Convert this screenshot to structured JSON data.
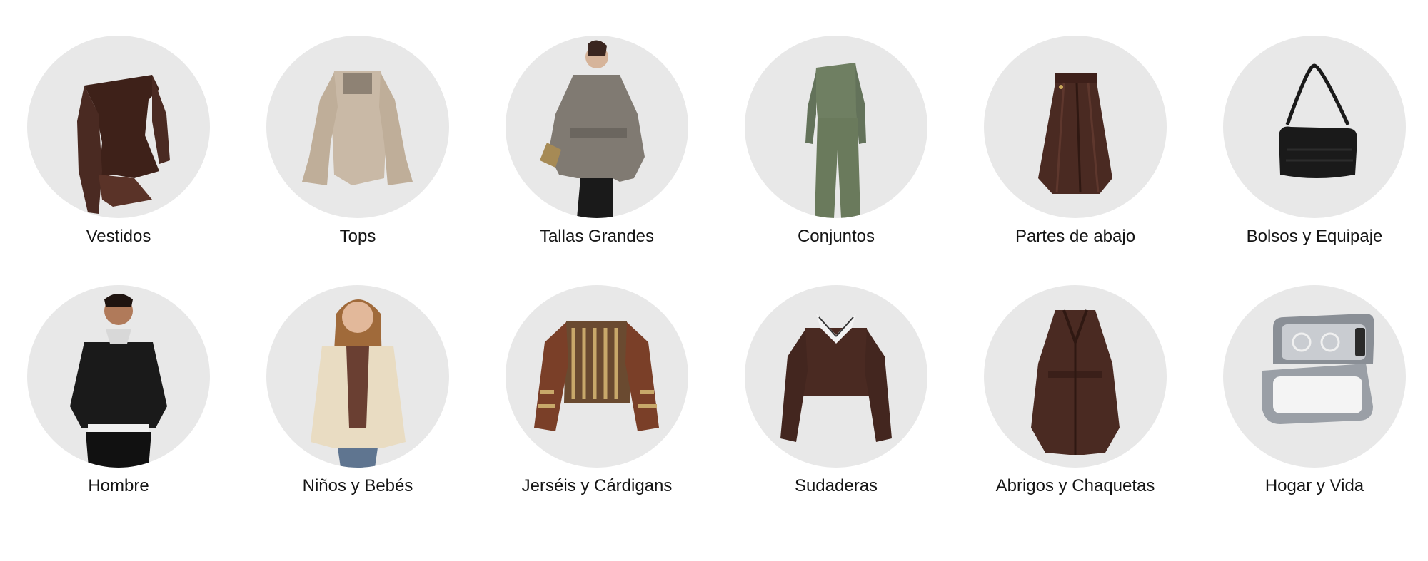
{
  "categories": [
    {
      "label": "Vestidos",
      "icon": "lace-dress-icon"
    },
    {
      "label": "Tops",
      "icon": "bell-sleeve-top-icon"
    },
    {
      "label": "Tallas Grandes",
      "icon": "belted-blazer-icon"
    },
    {
      "label": "Conjuntos",
      "icon": "two-piece-set-icon"
    },
    {
      "label": "Partes de abajo",
      "icon": "leather-skirt-icon"
    },
    {
      "label": "Bolsos y Equipaje",
      "icon": "shoulder-bag-icon"
    },
    {
      "label": "Hombre",
      "icon": "mens-hoodie-icon"
    },
    {
      "label": "Niños y Bebés",
      "icon": "kids-puffer-jacket-icon"
    },
    {
      "label": "Jerséis y Cárdigans",
      "icon": "patterned-sweater-icon"
    },
    {
      "label": "Sudaderas",
      "icon": "collared-sweatshirt-icon"
    },
    {
      "label": "Abrigos y Chaquetas",
      "icon": "trench-coat-icon"
    },
    {
      "label": "Hogar y Vida",
      "icon": "travel-organizer-icon"
    }
  ],
  "colors": {
    "circle_bg": "#e8e8e8",
    "text": "#141414",
    "brown": "#4a2a22",
    "beige": "#c9b9a6",
    "olive": "#6f7f62",
    "grey_jacket": "#807a72",
    "black": "#1a1a1a"
  }
}
